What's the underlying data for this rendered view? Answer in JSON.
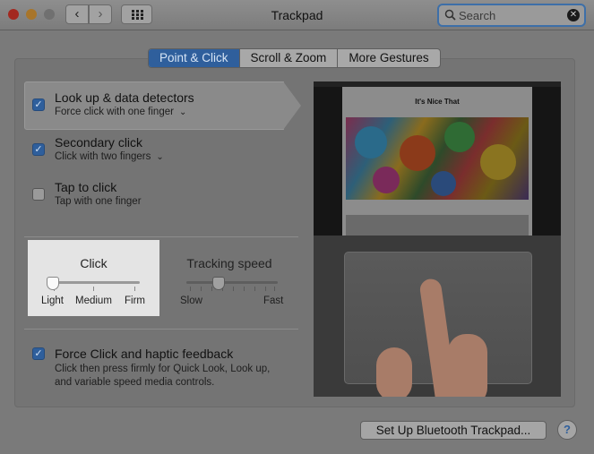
{
  "window": {
    "title": "Trackpad"
  },
  "search": {
    "placeholder": "Search"
  },
  "tabs": [
    {
      "label": "Point & Click",
      "active": true
    },
    {
      "label": "Scroll & Zoom",
      "active": false
    },
    {
      "label": "More Gestures",
      "active": false
    }
  ],
  "options": [
    {
      "title": "Look up & data detectors",
      "subtitle": "Force click with one finger",
      "checked": true,
      "has_menu": true
    },
    {
      "title": "Secondary click",
      "subtitle": "Click with two fingers",
      "checked": true,
      "has_menu": true
    },
    {
      "title": "Tap to click",
      "subtitle": "Tap with one finger",
      "checked": false,
      "has_menu": false
    }
  ],
  "click_slider": {
    "title": "Click",
    "labels": [
      "Light",
      "Medium",
      "Firm"
    ],
    "value": "Light"
  },
  "tracking_slider": {
    "title": "Tracking speed",
    "min_label": "Slow",
    "max_label": "Fast",
    "position": 0.35
  },
  "force_click": {
    "title": "Force Click and haptic feedback",
    "description_line1": "Click then press firmly for Quick Look, Look up,",
    "description_line2": "and variable speed media controls.",
    "checked": true
  },
  "preview": {
    "site_title": "It's Nice That"
  },
  "footer": {
    "bluetooth_button": "Set Up Bluetooth Trackpad...",
    "help_label": "?"
  },
  "colors": {
    "accent": "#2f5f9c",
    "window_bg": "#7a7a7a"
  }
}
